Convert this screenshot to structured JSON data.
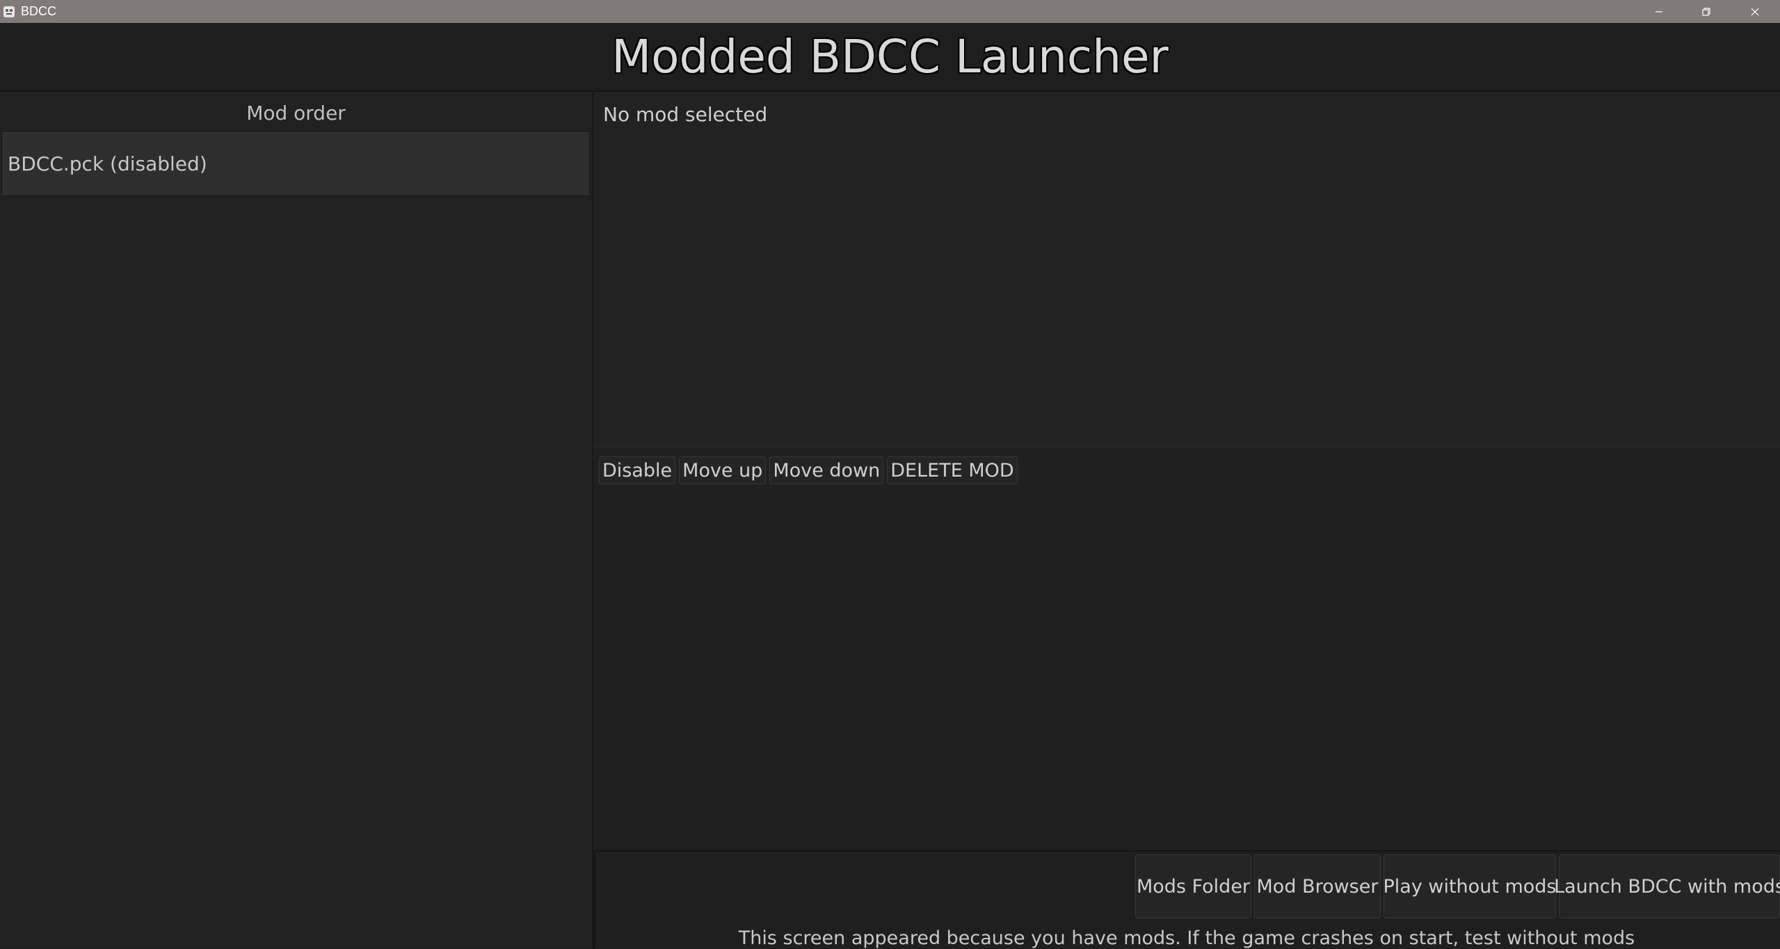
{
  "window": {
    "title": "BDCC",
    "controls": [
      "minimize-icon",
      "restore-icon",
      "close-icon"
    ]
  },
  "header": {
    "title": "Modded BDCC Launcher"
  },
  "mod_order": {
    "heading": "Mod order",
    "items": [
      {
        "label": "BDCC.pck (disabled)"
      }
    ]
  },
  "details": {
    "status": "No mod selected"
  },
  "mod_actions": {
    "disable": "Disable",
    "move_up": "Move up",
    "move_down": "Move down",
    "delete": "DELETE MOD"
  },
  "launch": {
    "mods_folder": "Mods Folder",
    "mod_browser": "Mod Browser",
    "play_without_mods": "Play without mods",
    "launch_with_mods": "Launch BDCC with mods"
  },
  "footer": {
    "note": "This screen appeared because you have mods. If the game crashes on start, test without mods"
  }
}
